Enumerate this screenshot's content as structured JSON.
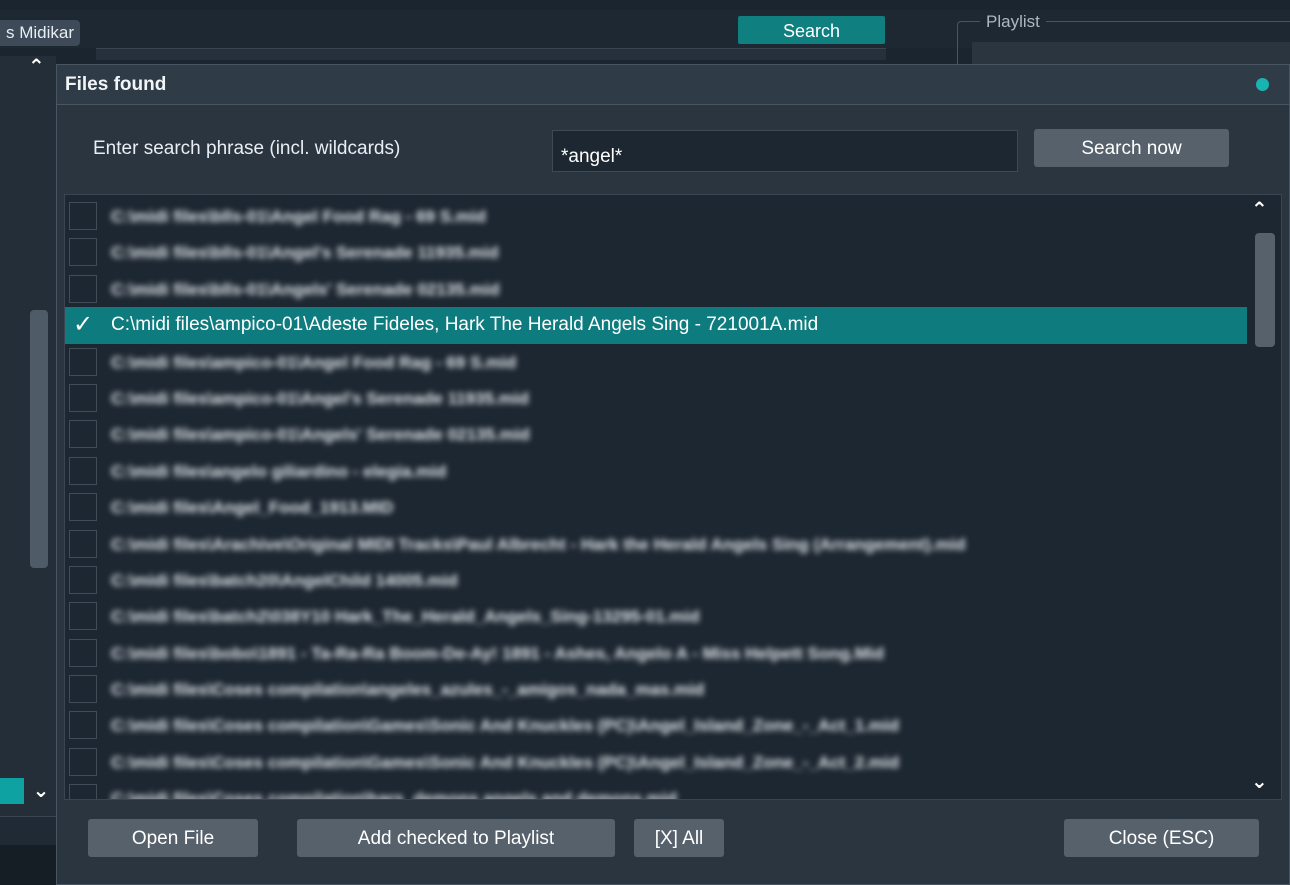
{
  "background": {
    "tab_label": "s Midikar",
    "search_button": "Search",
    "playlist_label": "Playlist"
  },
  "dialog": {
    "title": "Files found",
    "search_label": "Enter search phrase (incl. wildcards)",
    "search_value": "*angel*",
    "search_now": "Search now",
    "buttons": {
      "open_file": "Open File",
      "add_checked": "Add checked to Playlist",
      "check_all": "[X] All",
      "close": "Close (ESC)"
    }
  },
  "files": [
    {
      "path": "C:\\midi files\\blls-01\\Angel Food Rag - 69 S.mid",
      "checked": false,
      "blurred": true
    },
    {
      "path": "C:\\midi files\\blls-01\\Angel's Serenade 11935.mid",
      "checked": false,
      "blurred": true
    },
    {
      "path": "C:\\midi files\\blls-01\\Angels' Serenade 02135.mid",
      "checked": false,
      "blurred": true
    },
    {
      "path": "C:\\midi files\\ampico-01\\Adeste Fideles, Hark The Herald Angels Sing - 721001A.mid",
      "checked": true,
      "blurred": false
    },
    {
      "path": "C:\\midi files\\ampico-01\\Angel Food Rag - 69 S.mid",
      "checked": false,
      "blurred": true
    },
    {
      "path": "C:\\midi files\\ampico-01\\Angel's Serenade 11935.mid",
      "checked": false,
      "blurred": true
    },
    {
      "path": "C:\\midi files\\ampico-01\\Angels' Serenade 02135.mid",
      "checked": false,
      "blurred": true
    },
    {
      "path": "C:\\midi files\\angelo giliardino - elegia.mid",
      "checked": false,
      "blurred": true
    },
    {
      "path": "C:\\midi files\\Angel_Food_1913.MID",
      "checked": false,
      "blurred": true
    },
    {
      "path": "C:\\midi files\\Arachive\\Original MIDI Tracks\\Paul Albrecht - Hark the Herald Angels Sing (Arrangement).mid",
      "checked": false,
      "blurred": true
    },
    {
      "path": "C:\\midi files\\batch20\\AngelChild 14005.mid",
      "checked": false,
      "blurred": true
    },
    {
      "path": "C:\\midi files\\batch2\\038Y10 Hark_The_Herald_Angels_Sing-13295-01.mid",
      "checked": false,
      "blurred": true
    },
    {
      "path": "C:\\midi files\\bobo\\1891 - Ta-Ra-Ra Boom-De-Ay! 1891 - Ashes, Angelo A - Miss Helpett Song.Mid",
      "checked": false,
      "blurred": true
    },
    {
      "path": "C:\\midi files\\Coses compilation\\angeles_azules_-_amigos_nada_mas.mid",
      "checked": false,
      "blurred": true
    },
    {
      "path": "C:\\midi files\\Coses compilation\\Games\\Sonic And Knuckles (PC)\\Angel_Island_Zone_-_Act_1.mid",
      "checked": false,
      "blurred": true
    },
    {
      "path": "C:\\midi files\\Coses compilation\\Games\\Sonic And Knuckles (PC)\\Angel_Island_Zone_-_Act_2.mid",
      "checked": false,
      "blurred": true
    },
    {
      "path": "C:\\midi files\\Coses compilation\\hars_demons angels and demons.mid",
      "checked": false,
      "blurred": true
    }
  ],
  "colors": {
    "accent": "#0e7c7f",
    "dialog_bg": "#2a3540",
    "list_bg": "#1d2731",
    "button_bg": "#56616c"
  }
}
